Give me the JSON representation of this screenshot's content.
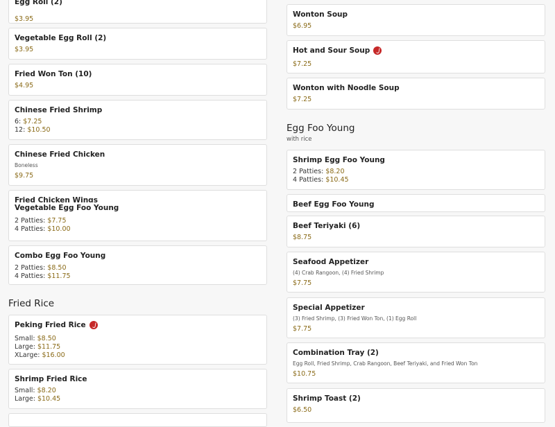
{
  "left": {
    "egg_roll": {
      "name": "Egg Roll (2)",
      "price": "$3.95"
    },
    "veg_egg_roll": {
      "name": "Vegetable Egg Roll (2)",
      "price": "$3.95"
    },
    "fried_won_ton": {
      "name": "Fried Won Ton (10)",
      "price": "$4.95"
    },
    "chinese_fried_shrimp": {
      "name": "Chinese Fried Shrimp",
      "l1": "6: ",
      "p1": "$7.25",
      "l2": "12: ",
      "p2": "$10.50"
    },
    "chinese_fried_chicken": {
      "name": "Chinese Fried Chicken",
      "desc": "Boneless",
      "price": "$9.75"
    },
    "fried_chicken_wings": {
      "name": "Fried Chicken Wings"
    },
    "veg_egg_foo_young": {
      "name": "Vegetable Egg Foo Young",
      "l1": "2 Patties: ",
      "p1": "$7.75",
      "l2": "4 Patties: ",
      "p2": "$10.00"
    },
    "combo_egg_foo_young": {
      "name": "Combo Egg Foo Young",
      "l1": "2 Patties: ",
      "p1": "$8.50",
      "l2": "4 Patties: ",
      "p2": "$11.75"
    },
    "fried_rice_title": "Fried Rice",
    "peking_fried_rice": {
      "name": "Peking Fried Rice",
      "l1": "Small: ",
      "p1": "$8.50",
      "l2": "Large: ",
      "p2": "$11.75",
      "l3": "XLarge: ",
      "p3": "$16.00"
    },
    "shrimp_fried_rice": {
      "name": "Shrimp Fried Rice",
      "l1": "Small: ",
      "p1": "$8.20",
      "l2": "Large: ",
      "p2": "$10.45"
    }
  },
  "right": {
    "wonton_soup": {
      "name": "Wonton Soup",
      "price": "$6.95"
    },
    "hot_sour_soup": {
      "name": "Hot and Sour Soup",
      "price": "$7.25"
    },
    "wonton_noodle_soup": {
      "name": "Wonton with Noodle Soup",
      "price": "$7.25"
    },
    "egg_foo_young_title": "Egg Foo Young",
    "egg_foo_young_sub": "with rice",
    "shrimp_egg_foo_young": {
      "name": "Shrimp Egg Foo Young",
      "l1": "2 Patties: ",
      "p1": "$8.20",
      "l2": "4 Patties: ",
      "p2": "$10.45"
    },
    "beef_egg_foo_young": {
      "name": "Beef Egg Foo Young"
    },
    "beef_teriyaki": {
      "name": "Beef Teriyaki (6)",
      "price": "$8.75"
    },
    "seafood_appetizer": {
      "name": "Seafood Appetizer",
      "desc": "(4) Crab Rangoon, (4) Fried Shrimp",
      "price": "$7.75"
    },
    "special_appetizer": {
      "name": "Special Appetizer",
      "desc": "(3) Fried Shrimp, (3) Fried Won Ton, (1) Egg Roll",
      "price": "$7.75"
    },
    "combination_tray": {
      "name": "Combination Tray (2)",
      "desc": "Egg Roll, Fried Shrimp, Crab Rangoon, Beef Teriyaki, and Fried Won Ton",
      "price": "$10.75"
    },
    "shrimp_toast": {
      "name": "Shrimp Toast (2)",
      "price": "$6.50"
    }
  },
  "icons": {
    "spicy": "hot-pepper-icon",
    "spicy_color": "#c62828"
  }
}
